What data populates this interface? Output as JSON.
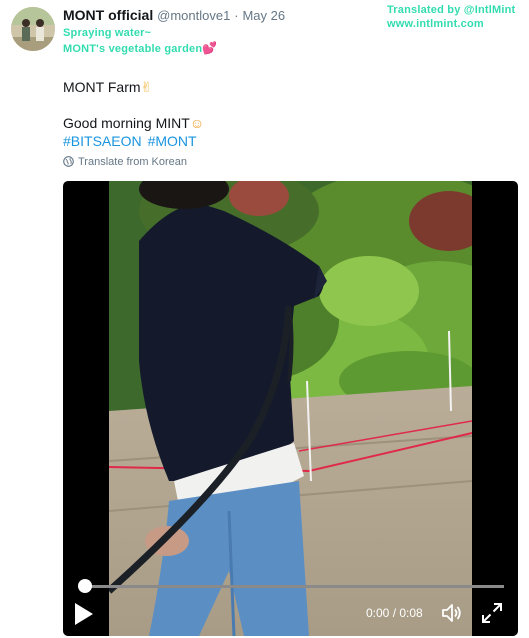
{
  "author": {
    "display_name": "MONT official",
    "handle": "@montlove1",
    "separator": "·",
    "date": "May 26"
  },
  "overlay": {
    "caption_line1": "Spraying water~",
    "caption_line2": "MONT's vegetable garden",
    "credit_line1": "Translated by @IntlMint",
    "credit_line2": "www.intlmint.com",
    "color": "#33dcb0"
  },
  "tweet": {
    "line1": "MONT Farm",
    "line1_emoji": "✌",
    "line2": "Good morning MINT",
    "line2_emoji": "☺",
    "hashtags": [
      "#BITSAEON",
      "#MONT"
    ]
  },
  "translate_link": "Translate from Korean",
  "video": {
    "progress": 0.01,
    "time_text": "0:00 / 0:08",
    "play_icon": "play-icon",
    "volume_icon": "volume-icon",
    "fullscreen_icon": "fullscreen-icon"
  },
  "colors": {
    "link": "#1b95e0",
    "secondary_text": "#657786",
    "video_bg": "#000000"
  }
}
